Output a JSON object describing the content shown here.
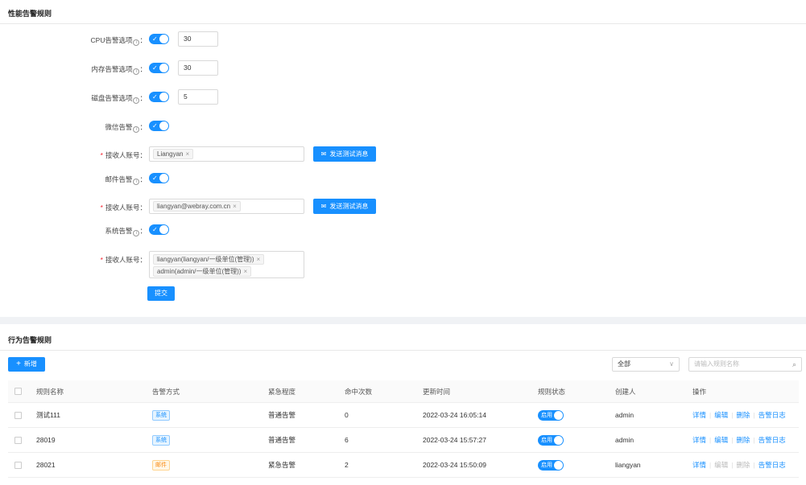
{
  "perf": {
    "title": "性能告警规则",
    "cpu": {
      "label": "CPU告警选项",
      "value": "30"
    },
    "memory": {
      "label": "内存告警选项",
      "value": "30"
    },
    "disk": {
      "label": "磁盘告警选项",
      "value": "5"
    },
    "wechat": {
      "label": "微信告警",
      "receiver_label": "接收人账号",
      "tags": [
        "Liangyan"
      ],
      "test_button": "发送测试消息"
    },
    "mail": {
      "label": "邮件告警",
      "receiver_label": "接收人账号",
      "tags": [
        "liangyan@webray.com.cn"
      ],
      "test_button": "发送测试消息"
    },
    "system": {
      "label": "系统告警",
      "receiver_label": "接收人账号",
      "tags": [
        "liangyan(liangyan/一级单位(管理))",
        "admin(admin/一级单位(管理))"
      ]
    },
    "submit": "提交",
    "colon": "："
  },
  "behavior": {
    "title": "行为告警规则",
    "add_button": "新增",
    "filter_select": "全部",
    "search_placeholder": "请输入规则名称",
    "columns": [
      "规则名称",
      "告警方式",
      "紧急程度",
      "命中次数",
      "更新时间",
      "规则状态",
      "创建人",
      "操作"
    ],
    "rows": [
      {
        "name": "测试111",
        "method": "系统",
        "level": "普通告警",
        "hits": "0",
        "updated": "2022-03-24 16:05:14",
        "status": "启用",
        "creator": "admin"
      },
      {
        "name": "28019",
        "method": "系统",
        "level": "普通告警",
        "hits": "6",
        "updated": "2022-03-24 15:57:27",
        "status": "启用",
        "creator": "admin"
      },
      {
        "name": "28021",
        "method": "邮件",
        "level": "紧急告警",
        "hits": "2",
        "updated": "2022-03-24 15:50:09",
        "status": "启用",
        "creator": "liangyan"
      }
    ],
    "actions": {
      "detail": "详情",
      "edit": "编辑",
      "delete": "删除",
      "log": "告警日志"
    }
  },
  "colors": {
    "primary": "#1890ff",
    "required": "#f5222d"
  }
}
